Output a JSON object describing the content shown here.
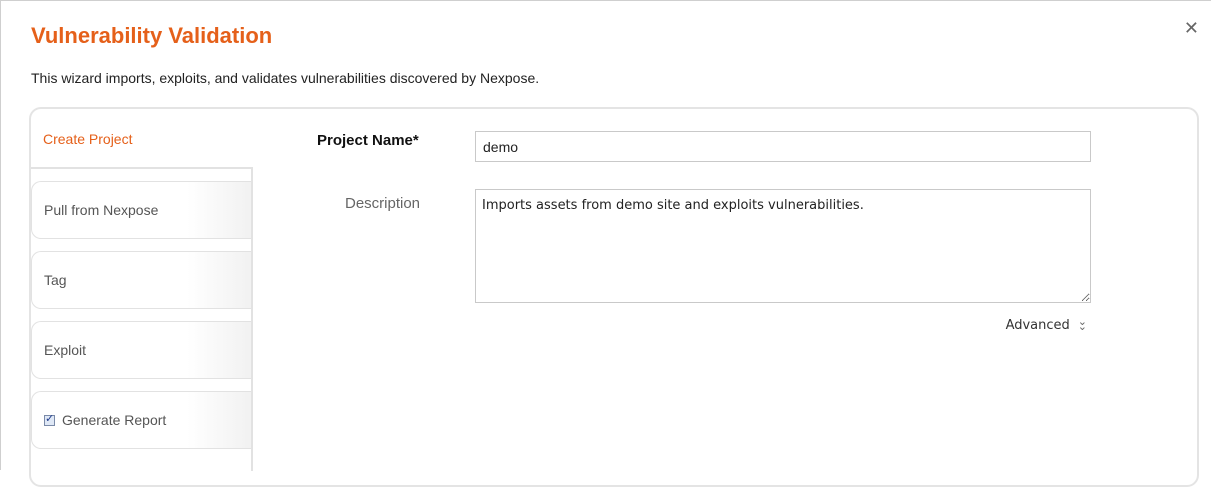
{
  "dialog": {
    "title": "Vulnerability Validation",
    "subtitle": "This wizard imports, exploits, and validates vulnerabilities discovered by Nexpose.",
    "close_icon": "close-icon"
  },
  "tabs": [
    {
      "label": "Create Project",
      "active": true
    },
    {
      "label": "Pull from Nexpose",
      "active": false
    },
    {
      "label": "Tag",
      "active": false
    },
    {
      "label": "Exploit",
      "active": false
    },
    {
      "label": "Generate Report",
      "active": false,
      "checkbox": true,
      "checked": true
    }
  ],
  "form": {
    "project_name_label": "Project Name*",
    "project_name_value": "demo",
    "description_label": "Description",
    "description_value": "Imports assets from demo site and exploits vulnerabilities.",
    "advanced_label": "Advanced",
    "advanced_icon": "double-chevron-down-icon"
  },
  "colors": {
    "accent": "#e5601a"
  }
}
